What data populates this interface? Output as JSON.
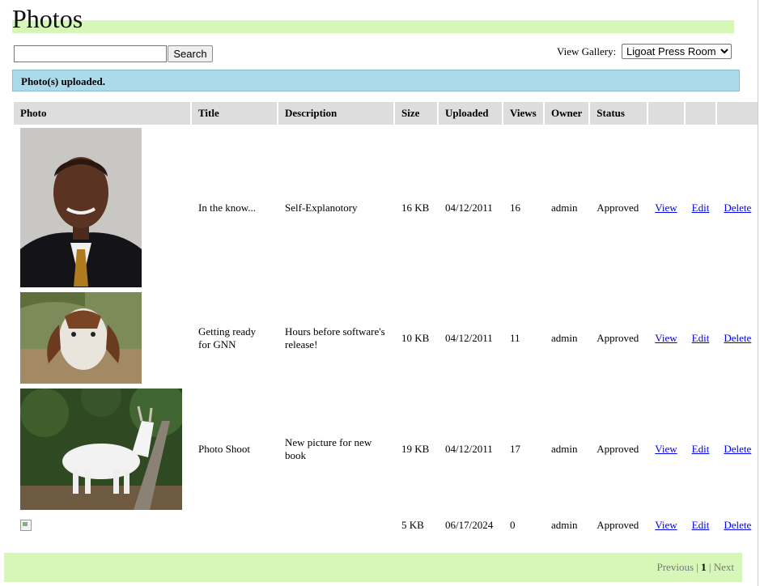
{
  "page": {
    "title": "Photos"
  },
  "search": {
    "value": "",
    "placeholder": "",
    "button_label": "Search"
  },
  "gallery": {
    "label": "View Gallery:",
    "selected": "Ligoat Press Room"
  },
  "notice": "Photo(s) uploaded.",
  "table": {
    "headers": [
      "Photo",
      "Title",
      "Description",
      "Size",
      "Uploaded",
      "Views",
      "Owner",
      "Status",
      "",
      "",
      ""
    ],
    "action_labels": {
      "view": "View",
      "edit": "Edit",
      "delete": "Delete"
    },
    "rows": [
      {
        "title": "In the know...",
        "description": "Self-Explanotory",
        "size": "16 KB",
        "uploaded": "04/12/2011",
        "views": "16",
        "owner": "admin",
        "status": "Approved",
        "thumbnail": "portrait-photo"
      },
      {
        "title": "Getting ready for GNN",
        "description": "Hours before software's release!",
        "size": "10 KB",
        "uploaded": "04/12/2011",
        "views": "11",
        "owner": "admin",
        "status": "Approved",
        "thumbnail": "brown-goat-photo"
      },
      {
        "title": "Photo Shoot",
        "description": "New picture for new book",
        "size": "19 KB",
        "uploaded": "04/12/2011",
        "views": "17",
        "owner": "admin",
        "status": "Approved",
        "thumbnail": "white-goat-photo"
      },
      {
        "title": "",
        "description": "",
        "size": "5 KB",
        "uploaded": "06/17/2024",
        "views": "0",
        "owner": "admin",
        "status": "Approved",
        "thumbnail": "broken-image"
      }
    ]
  },
  "pager": {
    "previous": "Previous",
    "separator": "|",
    "current": "1",
    "next": "Next"
  },
  "colors": {
    "header_green": "#d6f7b8",
    "notice_blue": "#abdbea",
    "table_header_gray": "#dddddd",
    "link_blue": "#0000ee"
  }
}
